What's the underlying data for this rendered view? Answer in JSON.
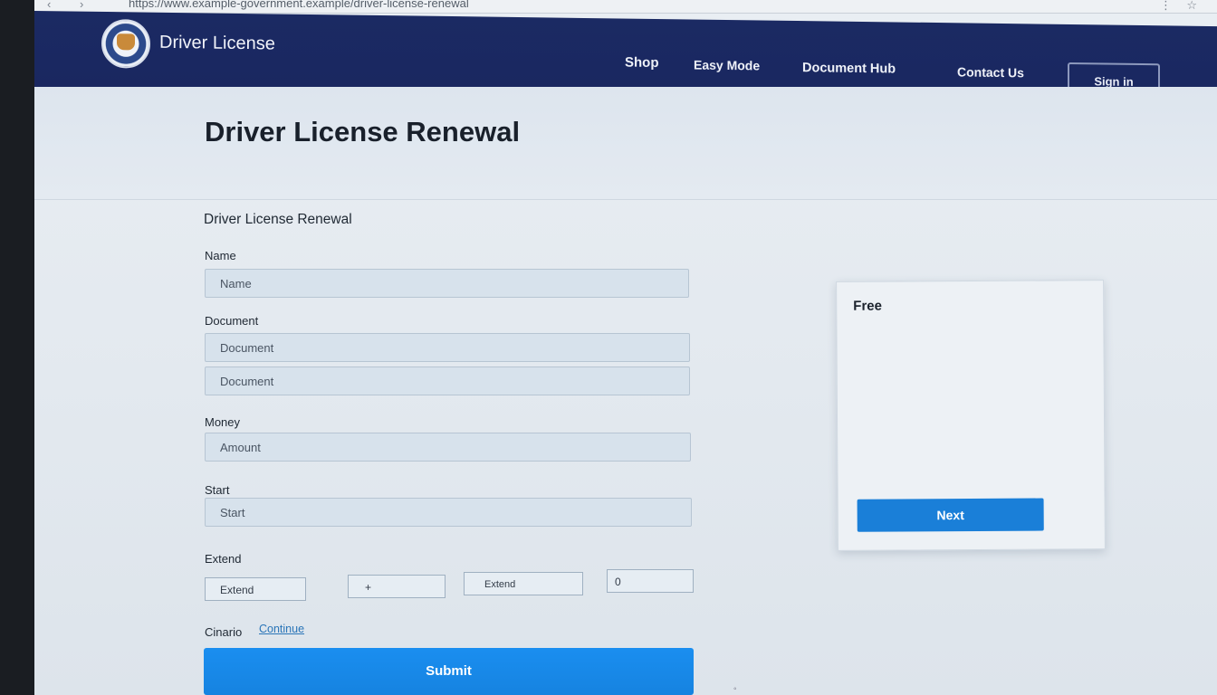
{
  "browser": {
    "address": "https://www.example-government.example/driver-license-renewal",
    "nav_buttons": "‹ ›",
    "menu_icon": "⋮",
    "star_icon": "☆"
  },
  "header": {
    "brand": "Driver License",
    "nav": [
      "Shop",
      "Easy Mode",
      "Document Hub",
      "Contact Us"
    ],
    "button": "Sign in"
  },
  "hero": {
    "title": "Driver License Renewal"
  },
  "form": {
    "intro": "Driver License Renewal",
    "fields": {
      "name_label": "Name",
      "name_placeholder": "Name",
      "document_label": "Document",
      "document_placeholder_1": "Document",
      "document_placeholder_2": "Document",
      "money_label": "Money",
      "money_placeholder": "Amount",
      "start_label": "Start",
      "start_placeholder": "Start",
      "extend_label": "Extend",
      "extend_option_1": "Extend",
      "extend_option_2": "+",
      "extend_option_3": "Extend",
      "extend_value": "0",
      "ciniano_label": "Cinario",
      "link_text": "Continue"
    },
    "submit_label": "Submit"
  },
  "sidecard": {
    "title": "Free",
    "paragraph_1": "",
    "paragraph_2": "",
    "paragraph_3": "",
    "button": "Next"
  },
  "colors": {
    "header_bg": "#1b2a63",
    "primary_button": "#1683e0",
    "card_button": "#1a7fd8",
    "link": "#2a75b8"
  }
}
